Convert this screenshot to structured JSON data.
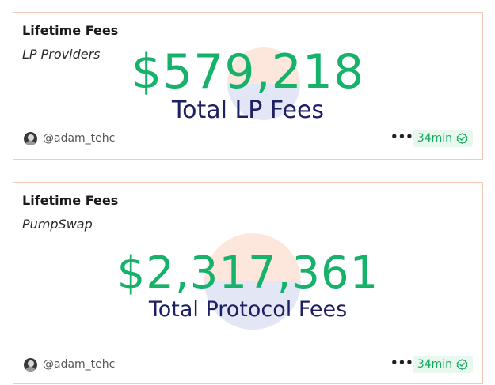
{
  "cards": [
    {
      "title": "Lifetime Fees",
      "subtitle": "LP Providers",
      "value": "$579,218",
      "value_label": "Total LP Fees",
      "author": "@adam_tehc",
      "more_label": "•••",
      "age": "34min",
      "icons": {
        "avatar": "avatar-icon",
        "more": "more-dots-icon",
        "verified": "check-circle-icon"
      }
    },
    {
      "title": "Lifetime Fees",
      "subtitle": "PumpSwap",
      "value": "$2,317,361",
      "value_label": "Total Protocol Fees",
      "author": "@adam_tehc",
      "more_label": "•••",
      "age": "34min",
      "icons": {
        "avatar": "avatar-icon",
        "more": "more-dots-icon",
        "verified": "check-circle-icon"
      }
    }
  ],
  "colors": {
    "value_green": "#17b26a",
    "label_navy": "#1e2061",
    "card_border": "#f6c9b8",
    "badge_bg": "#e8f8ef",
    "badge_text": "#17a85f"
  }
}
